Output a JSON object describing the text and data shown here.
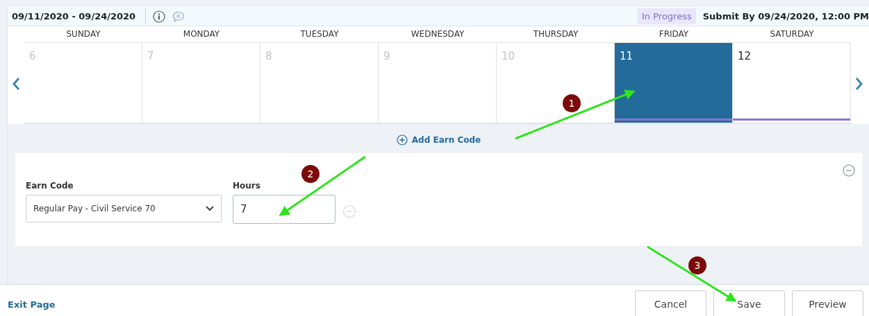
{
  "header": {
    "period": "09/11/2020 - 09/24/2020",
    "status": "In Progress",
    "deadline": "Submit By 09/24/2020, 12:00 PM"
  },
  "days": [
    {
      "weekday": "SUNDAY",
      "date": "6",
      "in_period": false,
      "selected": false,
      "has_entry": false
    },
    {
      "weekday": "MONDAY",
      "date": "7",
      "in_period": false,
      "selected": false,
      "has_entry": false
    },
    {
      "weekday": "TUESDAY",
      "date": "8",
      "in_period": false,
      "selected": false,
      "has_entry": false
    },
    {
      "weekday": "WEDNESDAY",
      "date": "9",
      "in_period": false,
      "selected": false,
      "has_entry": false
    },
    {
      "weekday": "THURSDAY",
      "date": "10",
      "in_period": false,
      "selected": false,
      "has_entry": false
    },
    {
      "weekday": "FRIDAY",
      "date": "11",
      "in_period": true,
      "selected": true,
      "has_entry": true
    },
    {
      "weekday": "SATURDAY",
      "date": "12",
      "in_period": true,
      "selected": false,
      "has_entry": true
    }
  ],
  "add_link": "Add Earn Code",
  "entry": {
    "earn_code_label": "Earn Code",
    "earn_code": "Regular Pay - Civil Service 70",
    "hours_label": "Hours",
    "hours": "7"
  },
  "footer": {
    "exit": "Exit Page",
    "buttons": [
      "Cancel",
      "Save",
      "Preview"
    ]
  },
  "annotations": [
    {
      "number": "1"
    },
    {
      "number": "2"
    },
    {
      "number": "3"
    }
  ]
}
